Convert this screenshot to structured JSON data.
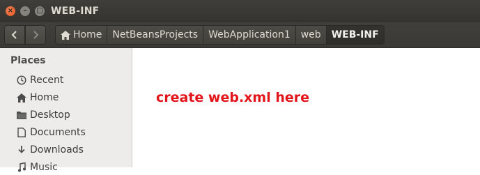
{
  "window": {
    "title": "WEB-INF",
    "close_glyph": "×",
    "minimize_glyph": "–",
    "maximize_glyph": "□"
  },
  "toolbar": {
    "back_icon": "chevron-left-icon",
    "forward_icon": "chevron-right-icon",
    "breadcrumbs": [
      {
        "label": "Home",
        "icon": "home-icon"
      },
      {
        "label": "NetBeansProjects"
      },
      {
        "label": "WebApplication1"
      },
      {
        "label": "web"
      },
      {
        "label": "WEB-INF",
        "active": true
      }
    ]
  },
  "sidebar": {
    "header": "Places",
    "items": [
      {
        "label": "Recent",
        "icon": "clock-icon"
      },
      {
        "label": "Home",
        "icon": "home-icon"
      },
      {
        "label": "Desktop",
        "icon": "folder-icon"
      },
      {
        "label": "Documents",
        "icon": "document-icon"
      },
      {
        "label": "Downloads",
        "icon": "download-icon"
      },
      {
        "label": "Music",
        "icon": "music-icon"
      }
    ]
  },
  "main": {
    "annotation": "create web.xml here"
  },
  "colors": {
    "annotation": "#e3141a",
    "titlebar": "#3c3b37",
    "sidebar": "#edecea"
  }
}
